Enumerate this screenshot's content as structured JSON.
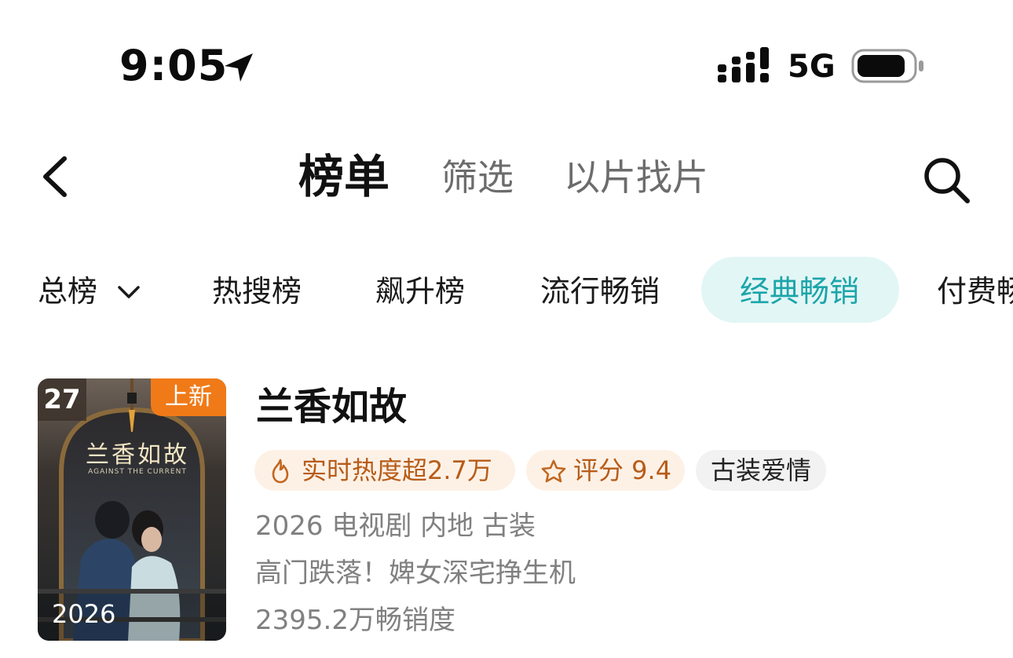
{
  "status_bar": {
    "time": "9:05",
    "network": "5G"
  },
  "nav": {
    "tabs": [
      {
        "label": "榜单",
        "active": true
      },
      {
        "label": "筛选",
        "active": false
      },
      {
        "label": "以片找片",
        "active": false
      }
    ]
  },
  "categories": [
    {
      "label": "总榜",
      "active": false,
      "dropdown": true
    },
    {
      "label": "热搜榜",
      "active": false
    },
    {
      "label": "飙升榜",
      "active": false
    },
    {
      "label": "流行畅销",
      "active": false
    },
    {
      "label": "经典畅销",
      "active": true
    },
    {
      "label": "付费畅",
      "active": false
    }
  ],
  "colors": {
    "accent": "#1ca5aa",
    "accent_bg": "#e3f6f6",
    "tag_orange_text": "#b75c18",
    "tag_orange_bg": "#fdf1e6",
    "new_badge": "#f07a18"
  },
  "item": {
    "rank": "27",
    "badge": "上新",
    "poster_title": "兰香如故",
    "poster_subtitle": "AGAINST THE CURRENT",
    "poster_year": "2026",
    "title": "兰香如故",
    "tags": {
      "heat": "实时热度超2.7万",
      "score": "评分 9.4",
      "genre": "古装爱情"
    },
    "info": "2026 电视剧 内地 古装",
    "description": "高门跌落！婢女深宅挣生机",
    "sales": "2395.2万畅销度"
  }
}
